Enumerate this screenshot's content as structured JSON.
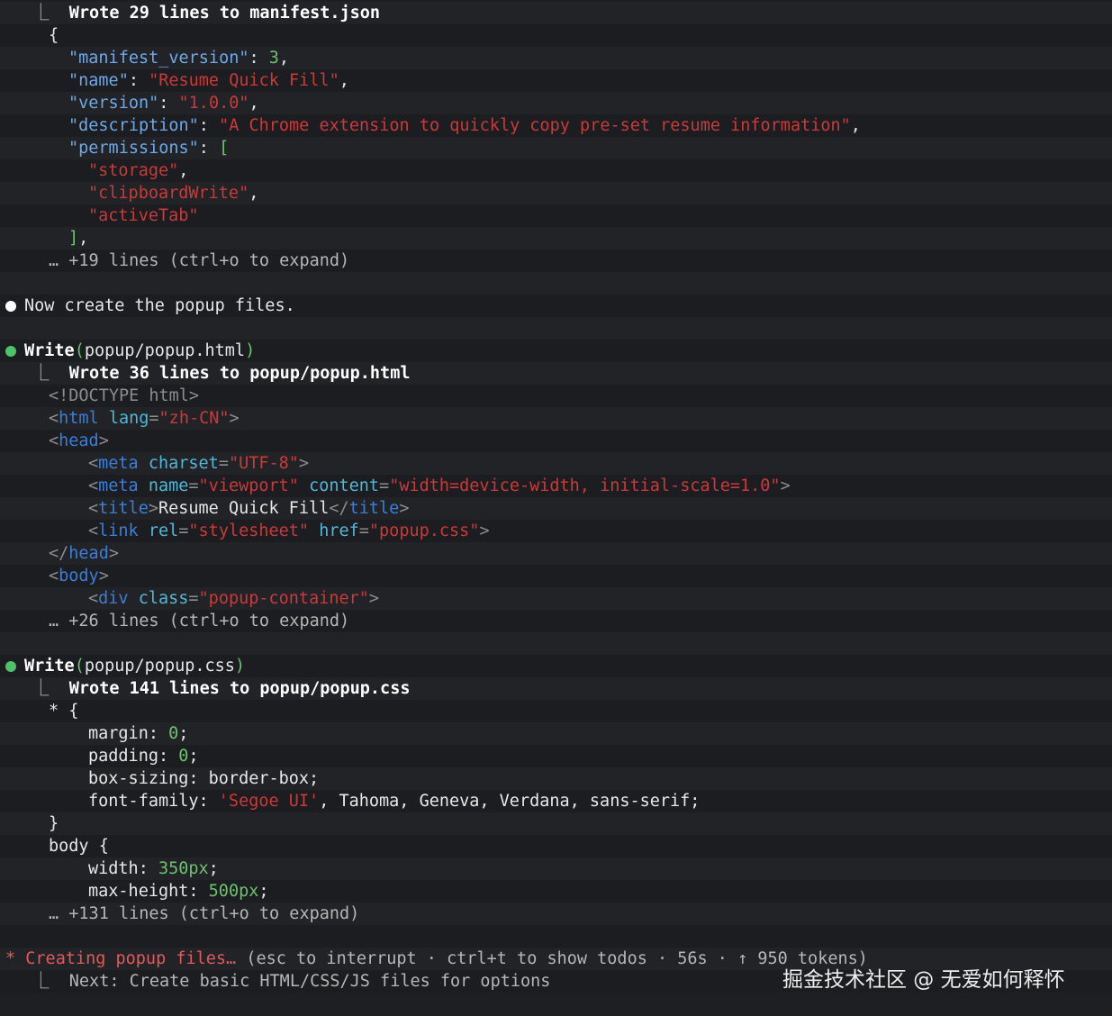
{
  "manifest_block": {
    "header": "Wrote 29 lines to manifest.json",
    "open_brace": "{",
    "k_manifest_version": "\"manifest_version\"",
    "v_manifest_version": "3",
    "k_name": "\"name\"",
    "v_name": "\"Resume Quick Fill\"",
    "k_version": "\"version\"",
    "v_version": "\"1.0.0\"",
    "k_description": "\"description\"",
    "v_description": "\"A Chrome extension to quickly copy pre-set resume information\"",
    "k_permissions": "\"permissions\"",
    "perm_storage": "\"storage\"",
    "perm_clipboard": "\"clipboardWrite\"",
    "perm_activetab": "\"activeTab\"",
    "expand_hint": "… +19 lines (ctrl+o to expand)"
  },
  "message": "Now create the popup files.",
  "html_block": {
    "tool": "Write",
    "path": "popup/popup.html",
    "header": "Wrote 36 lines to popup/popup.html",
    "doctype": "<!DOCTYPE html>",
    "lang_value": "\"zh-CN\"",
    "charset_value": "\"UTF-8\"",
    "name_value": "\"viewport\"",
    "content_value": "\"width=device-width, initial-scale=1.0\"",
    "title_text": "Resume Quick Fill",
    "rel_value": "\"stylesheet\"",
    "href_value": "\"popup.css\"",
    "class_value": "\"popup-container\"",
    "expand_hint": "… +26 lines (ctrl+o to expand)"
  },
  "css_block": {
    "tool": "Write",
    "path": "popup/popup.css",
    "header": "Wrote 141 lines to popup/popup.css",
    "selector_all": "* {",
    "margin": "margin:",
    "margin_val": "0",
    "padding": "padding:",
    "padding_val": "0",
    "box_sizing": "box-sizing: border-box;",
    "font_family": "font-family:",
    "font_first": "'Segoe UI'",
    "font_rest": ", Tahoma, Geneva, Verdana, sans-serif;",
    "close_brace": "}",
    "selector_body": "body {",
    "width": "width:",
    "width_val": "350px",
    "max_height": "max-height:",
    "max_height_val": "500px",
    "expand_hint": "… +131 lines (ctrl+o to expand)"
  },
  "status_line": {
    "star": "*",
    "label": "Creating popup files…",
    "details": " (esc to interrupt · ctrl+t to show todos · 56s · ↑ 950 tokens)",
    "next": "Next: Create basic HTML/CSS/JS files for options"
  },
  "watermark": "掘金技术社区 @ 无爱如何释怀"
}
